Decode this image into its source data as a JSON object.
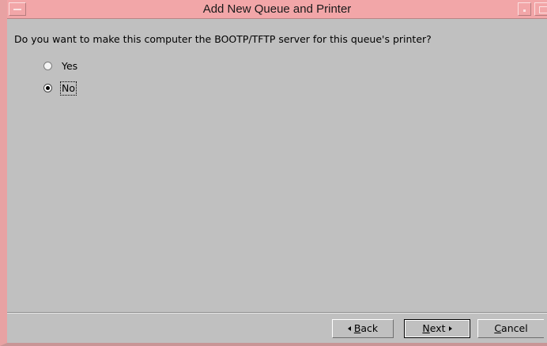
{
  "window": {
    "title": "Add New Queue and Printer"
  },
  "content": {
    "question": "Do you want to make this computer the BOOTP/TFTP server for this queue's printer?",
    "options": [
      {
        "label": "Yes",
        "selected": false
      },
      {
        "label": "No",
        "selected": true
      }
    ]
  },
  "buttons": {
    "back": {
      "mnemonic": "B",
      "rest": "ack"
    },
    "next": {
      "mnemonic": "N",
      "rest": "ext"
    },
    "cancel": {
      "mnemonic": "C",
      "rest": "ancel"
    }
  },
  "colors": {
    "titlebar": "#f2a6a8",
    "frame": "#e8a2a3",
    "background": "#c0c0c0"
  }
}
